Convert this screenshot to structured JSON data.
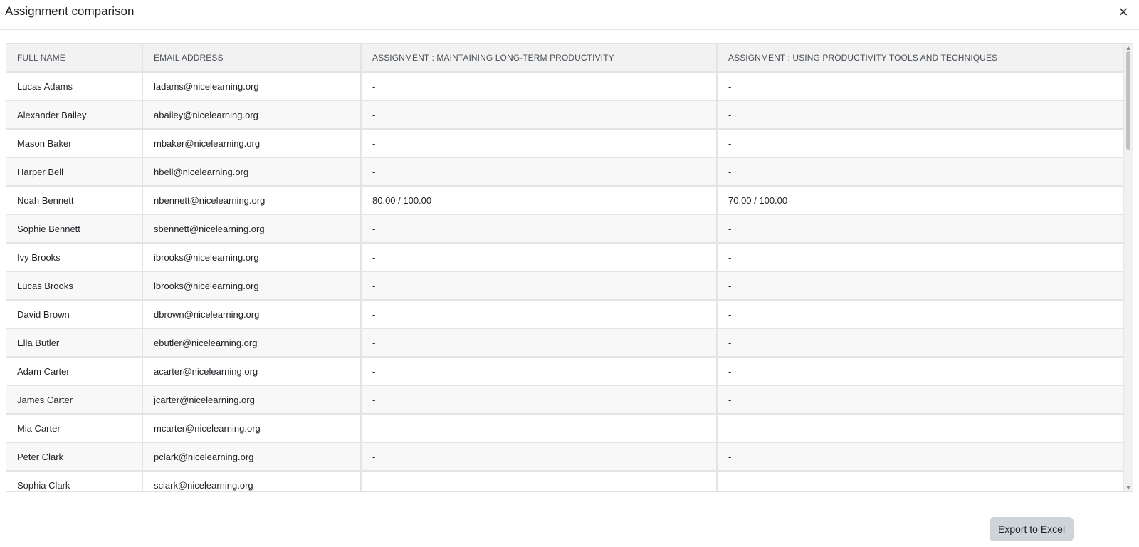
{
  "modal": {
    "title": "Assignment comparison",
    "close_label": "×"
  },
  "table": {
    "headers": [
      "FULL NAME",
      "EMAIL ADDRESS",
      "ASSIGNMENT : MAINTAINING LONG-TERM PRODUCTIVITY",
      "ASSIGNMENT : USING PRODUCTIVITY TOOLS AND TECHNIQUES"
    ],
    "rows": [
      [
        "Lucas Adams",
        "ladams@nicelearning.org",
        "-",
        "-"
      ],
      [
        "Alexander Bailey",
        "abailey@nicelearning.org",
        "-",
        "-"
      ],
      [
        "Mason Baker",
        "mbaker@nicelearning.org",
        "-",
        "-"
      ],
      [
        "Harper Bell",
        "hbell@nicelearning.org",
        "-",
        "-"
      ],
      [
        "Noah Bennett",
        "nbennett@nicelearning.org",
        "80.00 / 100.00",
        "70.00 / 100.00"
      ],
      [
        "Sophie Bennett",
        "sbennett@nicelearning.org",
        "-",
        "-"
      ],
      [
        "Ivy Brooks",
        "ibrooks@nicelearning.org",
        "-",
        "-"
      ],
      [
        "Lucas Brooks",
        "lbrooks@nicelearning.org",
        "-",
        "-"
      ],
      [
        "David Brown",
        "dbrown@nicelearning.org",
        "-",
        "-"
      ],
      [
        "Ella Butler",
        "ebutler@nicelearning.org",
        "-",
        "-"
      ],
      [
        "Adam Carter",
        "acarter@nicelearning.org",
        "-",
        "-"
      ],
      [
        "James Carter",
        "jcarter@nicelearning.org",
        "-",
        "-"
      ],
      [
        "Mia Carter",
        "mcarter@nicelearning.org",
        "-",
        "-"
      ],
      [
        "Peter Clark",
        "pclark@nicelearning.org",
        "-",
        "-"
      ],
      [
        "Sophia Clark",
        "sclark@nicelearning.org",
        "-",
        "-"
      ]
    ]
  },
  "scrollbar": {
    "up_icon": "▲",
    "down_icon": "▼"
  },
  "footer": {
    "export_label": "Export to Excel"
  }
}
